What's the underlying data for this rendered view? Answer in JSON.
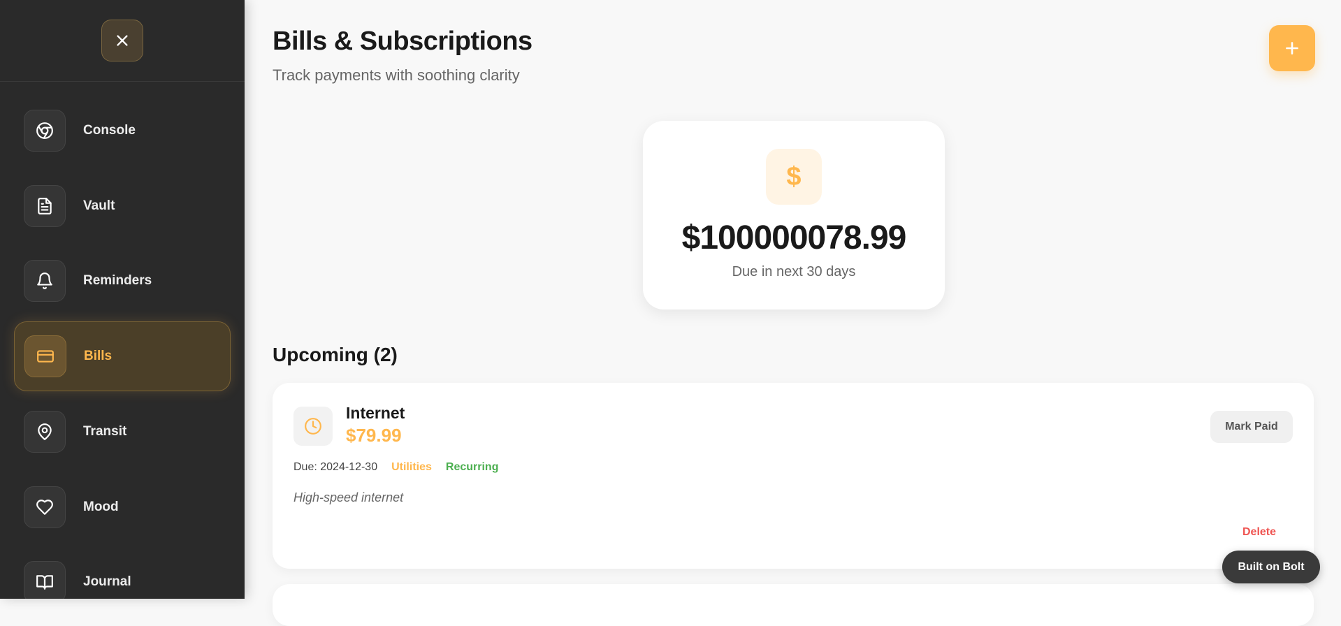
{
  "sidebar": {
    "close_icon": "close-icon",
    "items": [
      {
        "label": "Console",
        "icon": "chrome-icon"
      },
      {
        "label": "Vault",
        "icon": "document-icon"
      },
      {
        "label": "Reminders",
        "icon": "bell-icon"
      },
      {
        "label": "Bills",
        "icon": "credit-card-icon",
        "active": true
      },
      {
        "label": "Transit",
        "icon": "map-pin-icon"
      },
      {
        "label": "Mood",
        "icon": "heart-icon"
      },
      {
        "label": "Journal",
        "icon": "book-icon"
      }
    ]
  },
  "header": {
    "title": "Bills & Subscriptions",
    "subtitle": "Track payments with soothing clarity",
    "add_icon": "plus-icon"
  },
  "summary": {
    "icon": "$",
    "amount": "$100000078.99",
    "caption": "Due in next 30 days"
  },
  "upcoming": {
    "title": "Upcoming (2)",
    "bills": [
      {
        "name": "Internet",
        "amount": "$79.99",
        "due": "Due: 2024-12-30",
        "category": "Utilities",
        "recurring": "Recurring",
        "note": "High-speed internet",
        "mark_paid_label": "Mark Paid",
        "delete_label": "Delete",
        "icon": "clock-icon"
      }
    ]
  },
  "badge": {
    "label": "Built on Bolt"
  },
  "colors": {
    "accent": "#ffb74d",
    "sidebar_bg": "#2a2a2a",
    "danger": "#ef5350",
    "success": "#4caf50"
  }
}
